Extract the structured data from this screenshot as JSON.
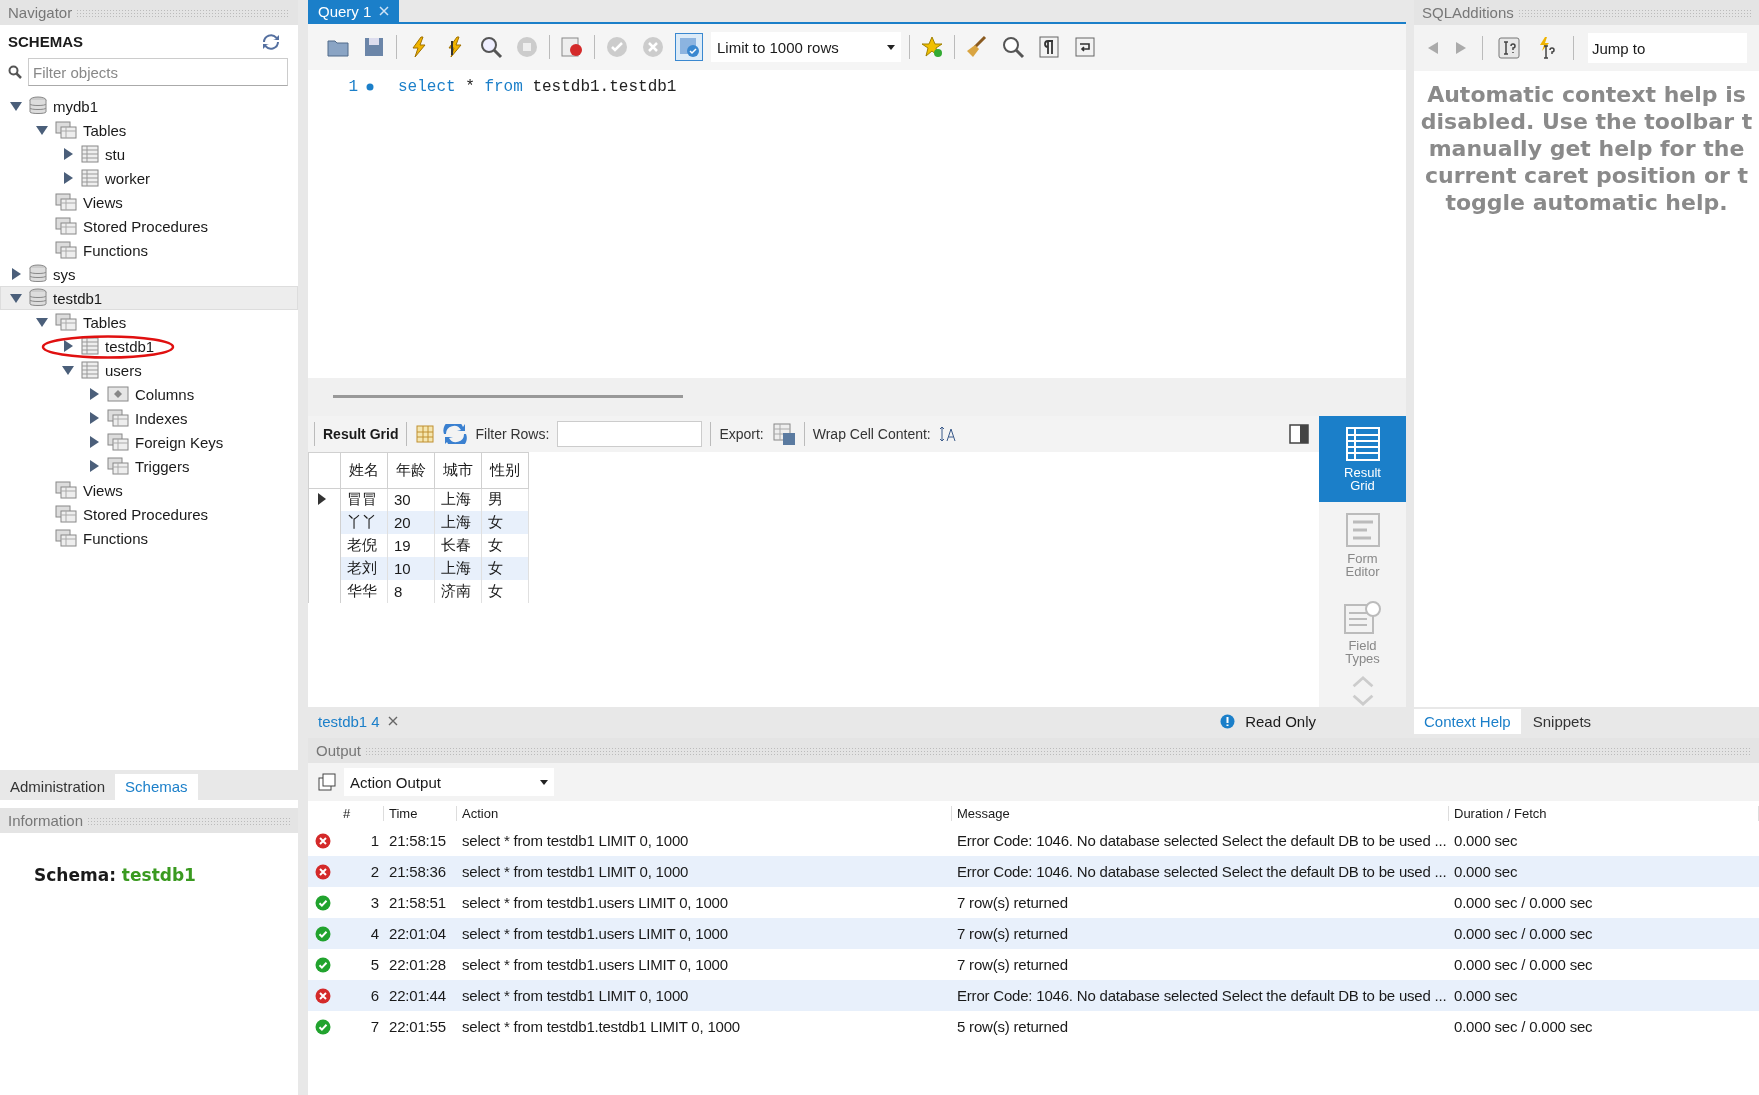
{
  "navigator": {
    "title": "Navigator",
    "heading": "SCHEMAS",
    "filter": {
      "placeholder": "Filter objects"
    },
    "tree": [
      {
        "label": "mydb1",
        "kind": "schema",
        "expanded": true,
        "selected": false,
        "circled": false,
        "children": [
          {
            "label": "Tables",
            "kind": "folder",
            "expanded": true,
            "selected": false,
            "circled": false,
            "children": [
              {
                "label": "stu",
                "kind": "table",
                "expanded": false,
                "selected": false,
                "circled": false
              },
              {
                "label": "worker",
                "kind": "table",
                "expanded": false,
                "selected": false,
                "circled": false
              }
            ]
          },
          {
            "label": "Views",
            "kind": "folder",
            "selected": false,
            "circled": false
          },
          {
            "label": "Stored Procedures",
            "kind": "folder",
            "selected": false,
            "circled": false
          },
          {
            "label": "Functions",
            "kind": "folder",
            "selected": false,
            "circled": false
          }
        ]
      },
      {
        "label": "sys",
        "kind": "schema",
        "expanded": false,
        "selected": false,
        "circled": false
      },
      {
        "label": "testdb1",
        "kind": "schema",
        "expanded": true,
        "selected": true,
        "circled": false,
        "children": [
          {
            "label": "Tables",
            "kind": "folder",
            "expanded": true,
            "selected": false,
            "circled": false,
            "children": [
              {
                "label": "testdb1",
                "kind": "table",
                "expanded": false,
                "selected": false,
                "circled": true
              },
              {
                "label": "users",
                "kind": "table",
                "expanded": true,
                "selected": false,
                "circled": false,
                "children": [
                  {
                    "label": "Columns",
                    "kind": "columns",
                    "expanded": false,
                    "selected": false,
                    "circled": false
                  },
                  {
                    "label": "Indexes",
                    "kind": "folder",
                    "expanded": false,
                    "selected": false,
                    "circled": false
                  },
                  {
                    "label": "Foreign Keys",
                    "kind": "folder",
                    "expanded": false,
                    "selected": false,
                    "circled": false
                  },
                  {
                    "label": "Triggers",
                    "kind": "folder",
                    "expanded": false,
                    "selected": false,
                    "circled": false
                  }
                ]
              }
            ]
          },
          {
            "label": "Views",
            "kind": "folder",
            "selected": false,
            "circled": false
          },
          {
            "label": "Stored Procedures",
            "kind": "folder",
            "selected": false,
            "circled": false
          },
          {
            "label": "Functions",
            "kind": "folder",
            "selected": false,
            "circled": false
          }
        ]
      }
    ]
  },
  "navigator_tabs": [
    {
      "label": "Administration",
      "selected": false
    },
    {
      "label": "Schemas",
      "selected": true
    }
  ],
  "information": {
    "title": "Information",
    "schema_label": "Schema:",
    "schema_name": "testdb1"
  },
  "query_tab": {
    "label": "Query 1"
  },
  "toolbar": {
    "limit": "Limit to 1000 rows",
    "autocommit_on": true
  },
  "editor": {
    "lines": [
      {
        "number": "1",
        "tokens": [
          {
            "kind": "keyword",
            "text": "select"
          },
          {
            "kind": "plain",
            "text": "*"
          },
          {
            "kind": "keyword",
            "text": "from"
          },
          {
            "kind": "plain",
            "text": "testdb1.testdb1"
          }
        ]
      }
    ]
  },
  "result": {
    "toolbar": {
      "result_grid": "Result Grid",
      "filter_label": "Filter Rows:",
      "export_label": "Export:",
      "wrap_label": "Wrap Cell Content:"
    },
    "columns": [
      "姓名",
      "年龄",
      "城市",
      "性别"
    ],
    "rows": [
      {
        "current": true,
        "cells": [
          "冒冒",
          "30",
          "上海",
          "男"
        ]
      },
      {
        "current": false,
        "cells": [
          "丫丫",
          "20",
          "上海",
          "女"
        ]
      },
      {
        "current": false,
        "cells": [
          "老倪",
          "19",
          "长春",
          "女"
        ]
      },
      {
        "current": false,
        "cells": [
          "老刘",
          "10",
          "上海",
          "女"
        ]
      },
      {
        "current": false,
        "cells": [
          "华华",
          "8",
          "济南",
          "女"
        ]
      }
    ],
    "side": [
      {
        "label": "Result Grid",
        "kind": "grid",
        "selected": true
      },
      {
        "label": "Form Editor",
        "kind": "form",
        "selected": false
      },
      {
        "label": "Field Types",
        "kind": "fields",
        "selected": false
      }
    ]
  },
  "result_tabs": [
    {
      "label": "testdb1 4",
      "selected": true
    }
  ],
  "read_only": "Read Only",
  "sql_additions": {
    "title": "SQLAdditions",
    "jump_to": "Jump to",
    "help_lines": [
      "Automatic context help is",
      "disabled. Use the toolbar t",
      "manually get help for the",
      "current caret position or t",
      "toggle automatic help."
    ],
    "tabs": [
      {
        "label": "Context Help",
        "selected": true
      },
      {
        "label": "Snippets",
        "selected": false
      }
    ]
  },
  "output": {
    "title": "Output",
    "mode": "Action Output",
    "columns": [
      "#",
      "Time",
      "Action",
      "Message",
      "Duration / Fetch"
    ],
    "rows": [
      {
        "kind": "error",
        "number": "1",
        "time": "21:58:15",
        "action": "select * from testdb1 LIMIT 0, 1000",
        "message": "Error Code: 1046. No database selected Select the default DB to be used ...",
        "duration": "0.000 sec"
      },
      {
        "kind": "error",
        "number": "2",
        "time": "21:58:36",
        "action": "select * from testdb1 LIMIT 0, 1000",
        "message": "Error Code: 1046. No database selected Select the default DB to be used ...",
        "duration": "0.000 sec"
      },
      {
        "kind": "ok",
        "number": "3",
        "time": "21:58:51",
        "action": "select * from testdb1.users LIMIT 0, 1000",
        "message": "7 row(s) returned",
        "duration": "0.000 sec / 0.000 sec"
      },
      {
        "kind": "ok",
        "number": "4",
        "time": "22:01:04",
        "action": "select * from testdb1.users LIMIT 0, 1000",
        "message": "7 row(s) returned",
        "duration": "0.000 sec / 0.000 sec"
      },
      {
        "kind": "ok",
        "number": "5",
        "time": "22:01:28",
        "action": "select * from testdb1.users LIMIT 0, 1000",
        "message": "7 row(s) returned",
        "duration": "0.000 sec / 0.000 sec"
      },
      {
        "kind": "error",
        "number": "6",
        "time": "22:01:44",
        "action": "select * from testdb1 LIMIT 0, 1000",
        "message": "Error Code: 1046. No database selected Select the default DB to be used ...",
        "duration": "0.000 sec"
      },
      {
        "kind": "ok",
        "number": "7",
        "time": "22:01:55",
        "action": "select * from testdb1.testdb1 LIMIT 0, 1000",
        "message": "5 row(s) returned",
        "duration": "0.000 sec / 0.000 sec"
      }
    ]
  }
}
